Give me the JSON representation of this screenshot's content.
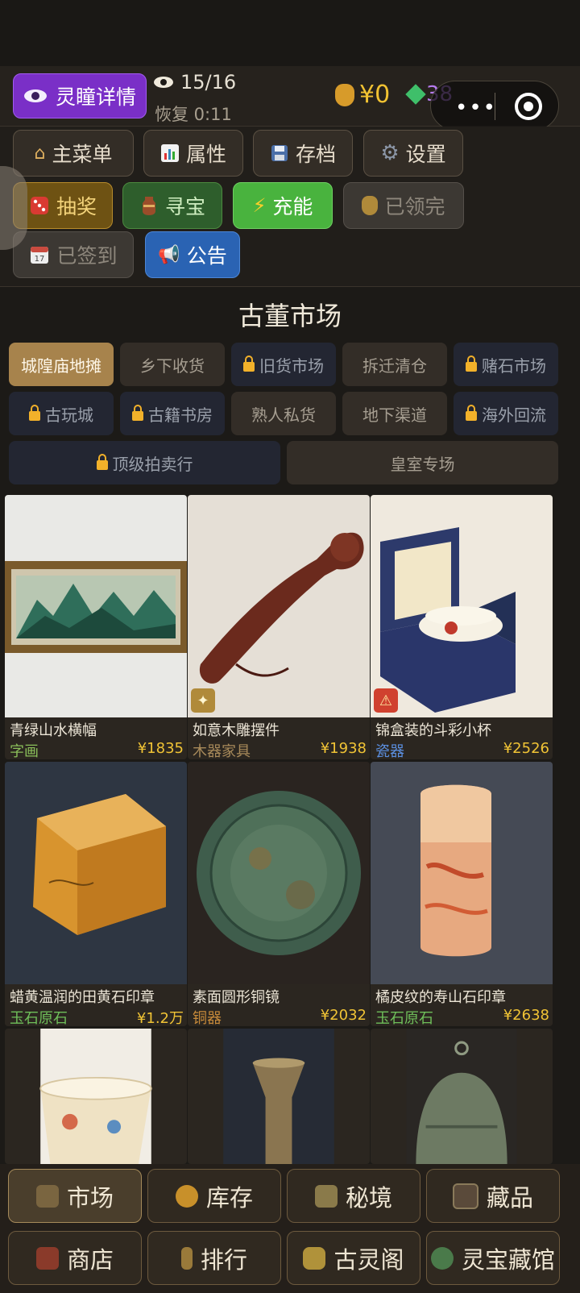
{
  "header": {
    "lingtong_label": "灵瞳详情",
    "eye_count": "15/16",
    "recover": "恢复 0:11",
    "money": "¥0",
    "gems": "38"
  },
  "menu": {
    "main": "主菜单",
    "attr": "属性",
    "save": "存档",
    "settings": "设置",
    "lottery": "抽奖",
    "treasure": "寻宝",
    "charge": "充能",
    "claimed": "已领完",
    "signed": "已签到",
    "notice": "公告"
  },
  "market": {
    "title": "古董市场",
    "tabs": [
      "城隍庙地摊",
      "乡下收货",
      "旧货市场",
      "拆迁清仓",
      "赌石市场",
      "古玩城",
      "古籍书房",
      "熟人私货",
      "地下渠道",
      "海外回流",
      "顶级拍卖行",
      "皇室专场"
    ]
  },
  "items": [
    {
      "name": "青绿山水横幅",
      "category": "字画",
      "price": "¥1835",
      "cat_color": "#8bbf5a"
    },
    {
      "name": "如意木雕摆件",
      "category": "木器家具",
      "price": "¥1938",
      "cat_color": "#a88a5a"
    },
    {
      "name": "锦盒装的斗彩小杯",
      "category": "瓷器",
      "price": "¥2526",
      "cat_color": "#5b8fe0"
    },
    {
      "name": "蜡黄温润的田黄石印章",
      "category": "玉石原石",
      "price": "¥1.2万",
      "cat_color": "#6fbf5a"
    },
    {
      "name": "素面圆形铜镜",
      "category": "铜器",
      "price": "¥2032",
      "cat_color": "#c98b3a"
    },
    {
      "name": "橘皮纹的寿山石印章",
      "category": "玉石原石",
      "price": "¥2638",
      "cat_color": "#6fbf5a"
    }
  ],
  "nav": {
    "market": "市场",
    "inventory": "库存",
    "secret": "秘境",
    "collection": "藏品",
    "shop": "商店",
    "rank": "排行",
    "pavilion": "古灵阁",
    "museum": "灵宝藏馆"
  }
}
